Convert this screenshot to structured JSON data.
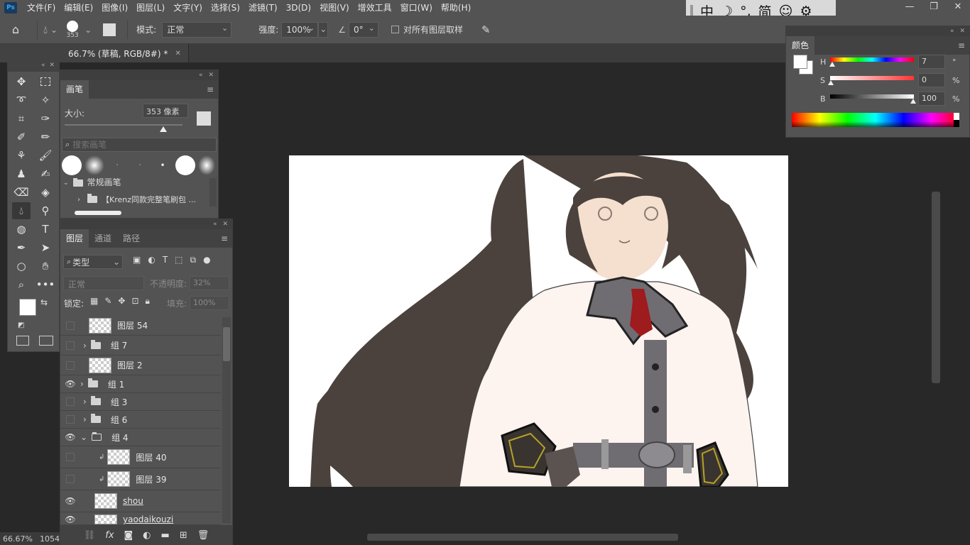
{
  "menubar": {
    "logo": "Ps",
    "items": [
      "文件(F)",
      "编辑(E)",
      "图像(I)",
      "图层(L)",
      "文字(Y)",
      "选择(S)",
      "滤镜(T)",
      "3D(D)",
      "视图(V)",
      "增效工具",
      "窗口(W)",
      "帮助(H)"
    ]
  },
  "ime": {
    "lang": "中",
    "moon": "☽",
    "punct": "°,",
    "script": "简",
    "emoji": "☺",
    "gear": "⚙"
  },
  "window_controls": {
    "minimize": "—",
    "restore": "❐",
    "close": "✕"
  },
  "options": {
    "brush_size": "353",
    "mode_label": "模式:",
    "mode_value": "正常",
    "strength_label": "强度:",
    "strength_value": "100%",
    "angle_value": "0°",
    "sample_all_label": "对所有图层取样"
  },
  "document": {
    "tab_title": "66.7% (草稿, RGB/8#) *",
    "zoom": "66.67%",
    "info": "1054"
  },
  "brush_panel": {
    "tab": "画笔",
    "size_label": "大小:",
    "size_value": "353 像素",
    "search_placeholder": "搜索画笔",
    "group_label": "常规画笔",
    "preset_folder": "【Krenz同款完整笔刷包 ..."
  },
  "layers_panel": {
    "tabs": [
      "图层",
      "通道",
      "路径"
    ],
    "filter_value": "类型",
    "blend_mode": "正常",
    "opacity_label": "不透明度:",
    "opacity_value": "32%",
    "lock_label": "锁定:",
    "fill_label": "填充:",
    "fill_value": "100%",
    "layers": [
      {
        "name": "图层 54",
        "type": "layer",
        "visible": false
      },
      {
        "name": "组 7",
        "type": "group",
        "visible": false
      },
      {
        "name": "图层 2",
        "type": "layer",
        "visible": false
      },
      {
        "name": "组 1",
        "type": "group",
        "visible": true
      },
      {
        "name": "组 3",
        "type": "group",
        "visible": false
      },
      {
        "name": "组 6",
        "type": "group",
        "visible": false
      },
      {
        "name": "组 4",
        "type": "group",
        "visible": true,
        "expanded": true
      },
      {
        "name": "图层 40",
        "type": "clipped",
        "visible": false
      },
      {
        "name": "图层 39",
        "type": "clipped",
        "visible": false
      },
      {
        "name": "shou",
        "type": "layer",
        "visible": true
      },
      {
        "name": "yaodaikouzi",
        "type": "layer",
        "visible": true
      }
    ]
  },
  "color_panel": {
    "tab": "颜色",
    "h_label": "H",
    "h_value": "7",
    "h_unit": "°",
    "s_label": "S",
    "s_value": "0",
    "s_unit": "%",
    "b_label": "B",
    "b_value": "100",
    "b_unit": "%"
  },
  "colors": {
    "hair": "#4b423d",
    "skin": "#f5dfcf",
    "coat": "#fdf3ef",
    "tie": "#9e1b1e",
    "gray": "#6f6c72",
    "gold": "#b5a326"
  }
}
